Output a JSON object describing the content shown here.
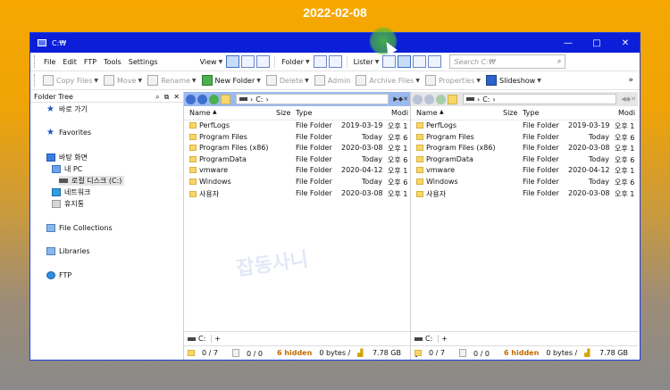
{
  "banner": {
    "date": "2022-02-08"
  },
  "window": {
    "title": "C:₩",
    "controls": {
      "minimize": "—",
      "maximize": "□",
      "close": "✕"
    }
  },
  "menu": [
    "File",
    "Edit",
    "FTP",
    "Tools",
    "Settings"
  ],
  "toolbar1": {
    "view_label": "View",
    "folder_label": "Folder",
    "lister_label": "Lister",
    "search_placeholder": "Search C:₩"
  },
  "toolbar2": {
    "copy_files": "Copy Files",
    "move": "Move",
    "rename": "Rename",
    "new_folder": "New Folder",
    "delete": "Delete",
    "admin": "Admin",
    "archive_files": "Archive Files",
    "properties": "Properties",
    "slideshow": "Slideshow",
    "more": "»"
  },
  "tree": {
    "header": "Folder Tree",
    "items": [
      "바로 가기",
      "Favorites",
      "바탕 화면",
      "내 PC",
      "로컬 디스크 (C:)",
      "네트워크",
      "휴지통",
      "File Collections",
      "Libraries",
      "FTP"
    ]
  },
  "panes": [
    {
      "path": "C:",
      "columns": {
        "name": "Name",
        "size": "Size",
        "type": "Type",
        "modified": "Modi"
      },
      "rows": [
        {
          "name": "PerfLogs",
          "type": "File Folder",
          "date": "2019-03-19",
          "time": "오후 1"
        },
        {
          "name": "Program Files",
          "type": "File Folder",
          "date": "Today",
          "time": "오후 6"
        },
        {
          "name": "Program Files (x86)",
          "type": "File Folder",
          "date": "2020-03-08",
          "time": "오후 1"
        },
        {
          "name": "ProgramData",
          "type": "File Folder",
          "date": "Today",
          "time": "오후 6"
        },
        {
          "name": "vmware",
          "type": "File Folder",
          "date": "2020-04-12",
          "time": "오후 1"
        },
        {
          "name": "Windows",
          "type": "File Folder",
          "date": "Today",
          "time": "오후 6"
        },
        {
          "name": "사용자",
          "type": "File Folder",
          "date": "2020-03-08",
          "time": "오후 1"
        }
      ],
      "tab_label": "C:",
      "status": {
        "selected": "0 / 7",
        "dirs": "0 / 0",
        "hidden": "6 hidden",
        "bytes": "0 bytes /",
        "free": "7.78 GB",
        "usage_fraction": 0.55
      }
    },
    {
      "path": "C:",
      "columns": {
        "name": "Name",
        "size": "Size",
        "type": "Type",
        "modified": "Modi"
      },
      "rows": [
        {
          "name": "PerfLogs",
          "type": "File Folder",
          "date": "2019-03-19",
          "time": "오후 1"
        },
        {
          "name": "Program Files",
          "type": "File Folder",
          "date": "Today",
          "time": "오후 6"
        },
        {
          "name": "Program Files (x86)",
          "type": "File Folder",
          "date": "2020-03-08",
          "time": "오후 1"
        },
        {
          "name": "ProgramData",
          "type": "File Folder",
          "date": "Today",
          "time": "오후 6"
        },
        {
          "name": "vmware",
          "type": "File Folder",
          "date": "2020-04-12",
          "time": "오후 1"
        },
        {
          "name": "Windows",
          "type": "File Folder",
          "date": "Today",
          "time": "오후 6"
        },
        {
          "name": "사용자",
          "type": "File Folder",
          "date": "2020-03-08",
          "time": "오후 1"
        }
      ],
      "tab_label": "C:",
      "status": {
        "selected": "0 / 7",
        "dirs": "0 / 0",
        "hidden": "6 hidden",
        "bytes": "0 bytes /",
        "free": "7.78 GB",
        "usage_fraction": 0.55
      }
    }
  ],
  "watermark": "잡동사니"
}
